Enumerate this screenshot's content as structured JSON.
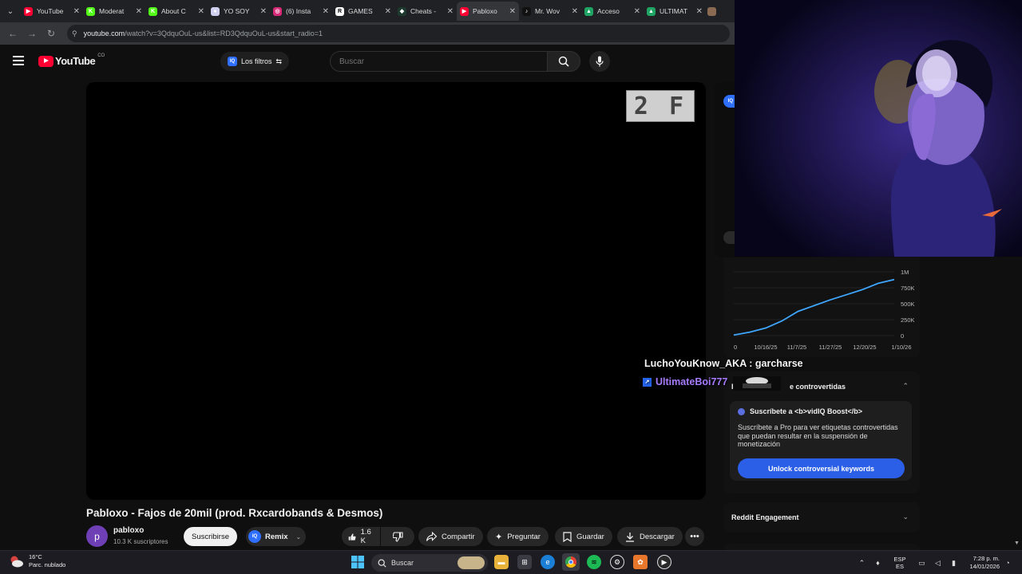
{
  "browser": {
    "tabs": [
      {
        "title": "YouTube",
        "favicon_color": "#ff0033",
        "favicon_glyph": "▶",
        "active": false
      },
      {
        "title": "Moderat",
        "favicon_color": "#53fc18",
        "favicon_glyph": "K",
        "active": false
      },
      {
        "title": "About C",
        "favicon_color": "#53fc18",
        "favicon_glyph": "K",
        "active": false
      },
      {
        "title": "YO SOY",
        "favicon_color": "#cfd0f0",
        "favicon_glyph": "●",
        "active": false
      },
      {
        "title": "(6) Insta",
        "favicon_color": "#d62976",
        "favicon_glyph": "◎",
        "active": false
      },
      {
        "title": "GAMES",
        "favicon_color": "#ffffff",
        "favicon_glyph": "R",
        "active": false
      },
      {
        "title": "Cheats -",
        "favicon_color": "#1e3a2f",
        "favicon_glyph": "◆",
        "active": false
      },
      {
        "title": "Pabloxo",
        "favicon_color": "#ff0033",
        "favicon_glyph": "▶",
        "active": true
      },
      {
        "title": "Mr. Wov",
        "favicon_color": "#111111",
        "favicon_glyph": "♪",
        "active": false
      },
      {
        "title": "Acceso",
        "favicon_color": "#1fa463",
        "favicon_glyph": "▲",
        "active": false
      },
      {
        "title": "ULTIMAT",
        "favicon_color": "#1fa463",
        "favicon_glyph": "▲",
        "active": false
      }
    ],
    "url_host": "youtube.com",
    "url_path": "/watch?v=3QdquOuL-us&list=RD3QdquOuL-us&start_radio=1"
  },
  "youtube": {
    "logo_text": "YouTube",
    "country_code": "CO",
    "filters_label": "Los filtros",
    "search_placeholder": "Buscar",
    "thumb_text": "2 F",
    "video": {
      "title": "Pabloxo - Fajos de 20mil (prod. Rxcardobands & Desmos)",
      "channel_initial": "p",
      "channel_name": "pabloxo",
      "subscribers": "10.3 K suscriptores",
      "subscribe_label": "Suscribirse",
      "remix_label": "Remix",
      "like_count": "1.6 K",
      "share_label": "Compartir",
      "ask_label": "Preguntar",
      "save_label": "Guardar",
      "download_label": "Descargar"
    }
  },
  "vidiq": {
    "badge": "IQ",
    "chart_ticks_y": [
      "1M",
      "750K",
      "500K",
      "250K",
      "0"
    ],
    "chart_ticks_x": [
      "0",
      "10/16/25",
      "11/7/25",
      "11/27/25",
      "12/20/25",
      "1/10/26"
    ],
    "controversial_title": "Palabras clave controvertidas",
    "controversial_visible_prefix": "Pa",
    "controversial_visible_suffix": "e controvertidas",
    "boost_text": "Suscríbete a <b>vidIQ Boost</b>",
    "boost_desc": "Suscríbete a Pro para ver etiquetas controvertidas que puedan resultar en la suspensión de monetización",
    "unlock_label": "Unlock controversial keywords",
    "reddit_title": "Reddit Engagement"
  },
  "chart_data": {
    "type": "area",
    "title": "",
    "xlabel": "",
    "ylabel": "",
    "x": [
      "10/4/25",
      "10/16/25",
      "10/27/25",
      "11/7/25",
      "11/17/25",
      "11/27/25",
      "12/8/25",
      "12/20/25",
      "12/30/25",
      "1/10/26",
      "1/14/26"
    ],
    "series": [
      {
        "values": [
          10000,
          55000,
          120000,
          230000,
          380000,
          470000,
          560000,
          640000,
          720000,
          820000,
          880000
        ]
      }
    ],
    "ylim": [
      0,
      1000000
    ],
    "color": "#3ea6ff"
  },
  "stream_chat": {
    "line1": "LuchoYouKnow_AKA : garcharse",
    "line2_user": "UltimateBoi777"
  },
  "taskbar": {
    "temperature": "16°C",
    "weather_desc": "Parc. nublado",
    "search_label": "Buscar",
    "lang_top": "ESP",
    "lang_bottom": "ES",
    "time": "7:28 p. m.",
    "date": "14/01/2026"
  }
}
